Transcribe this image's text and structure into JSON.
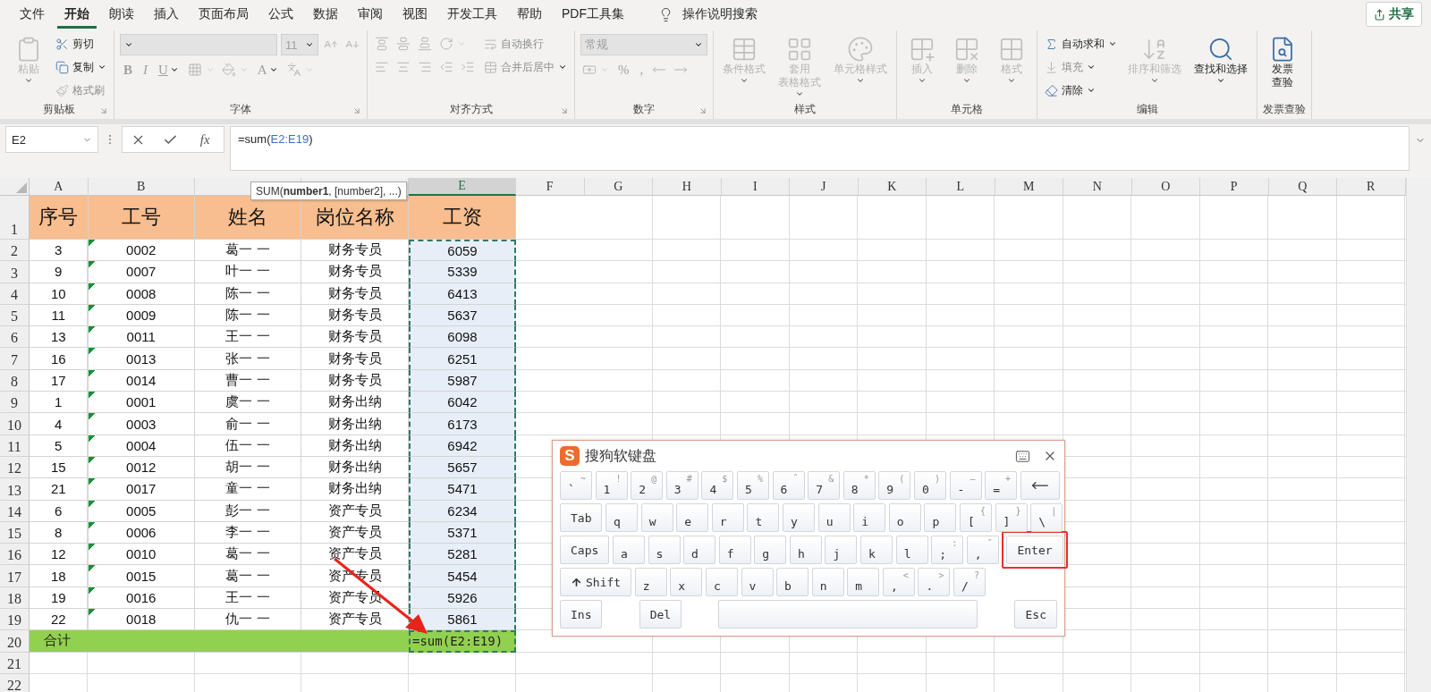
{
  "menu": {
    "tabs": [
      {
        "label": "文件",
        "selected": false
      },
      {
        "label": "开始",
        "selected": true
      },
      {
        "label": "朗读",
        "selected": false
      },
      {
        "label": "插入",
        "selected": false
      },
      {
        "label": "页面布局",
        "selected": false
      },
      {
        "label": "公式",
        "selected": false
      },
      {
        "label": "数据",
        "selected": false
      },
      {
        "label": "审阅",
        "selected": false
      },
      {
        "label": "视图",
        "selected": false
      },
      {
        "label": "开发工具",
        "selected": false
      },
      {
        "label": "帮助",
        "selected": false
      },
      {
        "label": "PDF工具集",
        "selected": false
      }
    ],
    "search": "操作说明搜索",
    "share": "共享"
  },
  "ribbon": {
    "groups": [
      {
        "label": "剪贴板",
        "launcher": true,
        "columns": [
          [
            [
              {
                "kind": "large",
                "label": "粘贴",
                "disabled": true,
                "dropdown": true
              }
            ]
          ],
          [
            [
              {
                "kind": "small",
                "label": "剪切",
                "disabled": false,
                "dropdown": false
              }
            ],
            [
              {
                "kind": "small",
                "label": "复制",
                "disabled": false,
                "dropdown": true
              }
            ],
            [
              {
                "kind": "small",
                "label": "格式刷",
                "disabled": true,
                "dropdown": false
              }
            ]
          ]
        ]
      },
      {
        "label": "字体",
        "launcher": true,
        "columns": [
          [
            [
              {
                "kind": "wide-field",
                "disabled": true,
                "dropdown": true
              },
              {
                "kind": "narrow-field",
                "label": "11",
                "disabled": true,
                "dropdown": true
              },
              {
                "kind": "icon",
                "disabled": true,
                "dropdown": false
              },
              {
                "kind": "icon",
                "disabled": true,
                "dropdown": false
              }
            ],
            [
              {
                "kind": "bold",
                "label": "B",
                "disabled": true,
                "dropdown": false
              },
              {
                "kind": "italic",
                "label": "I",
                "disabled": true,
                "dropdown": false
              },
              {
                "kind": "underline",
                "label": "U",
                "disabled": true,
                "dropdown": true
              },
              {
                "kind": "icon",
                "disabled": true,
                "dropdown": true
              },
              {
                "kind": "icon",
                "disabled": true,
                "dropdown": true
              },
              {
                "kind": "glyph",
                "label": "A",
                "disabled": true,
                "dropdown": true
              },
              {
                "kind": "icon",
                "disabled": true,
                "dropdown": true
              }
            ]
          ]
        ]
      },
      {
        "label": "对齐方式",
        "launcher": true,
        "columns": [
          [
            [
              {
                "kind": "icon",
                "disabled": true,
                "dropdown": false
              },
              {
                "kind": "icon",
                "disabled": true,
                "dropdown": false
              },
              {
                "kind": "icon",
                "disabled": true,
                "dropdown": false
              },
              {
                "kind": "icon",
                "disabled": true,
                "dropdown": true
              }
            ],
            [
              {
                "kind": "icon",
                "disabled": true,
                "dropdown": false
              },
              {
                "kind": "icon",
                "disabled": true,
                "dropdown": false
              },
              {
                "kind": "icon",
                "disabled": true,
                "dropdown": false
              },
              {
                "kind": "icon",
                "disabled": true,
                "dropdown": false
              },
              {
                "kind": "icon",
                "disabled": true,
                "dropdown": false
              }
            ]
          ],
          [
            [
              {
                "kind": "small",
                "label": "自动换行",
                "disabled": true,
                "dropdown": false
              }
            ],
            [
              {
                "kind": "small",
                "label": "合并后居中",
                "disabled": true,
                "dropdown": true
              }
            ]
          ]
        ]
      },
      {
        "label": "数字",
        "launcher": true,
        "columns": [
          [
            [
              {
                "kind": "medium-field",
                "label": "常规",
                "disabled": true,
                "dropdown": true
              }
            ],
            [
              {
                "kind": "icon",
                "disabled": true,
                "dropdown": true
              },
              {
                "kind": "glyph",
                "label": "%",
                "disabled": true,
                "dropdown": false
              },
              {
                "kind": "glyph",
                "label": ",",
                "disabled": true,
                "dropdown": false
              },
              {
                "kind": "icon",
                "disabled": true,
                "dropdown": false
              },
              {
                "kind": "icon",
                "disabled": true,
                "dropdown": false
              }
            ]
          ]
        ]
      },
      {
        "label": "样式",
        "launcher": false,
        "columns": [
          [
            [
              {
                "kind": "large",
                "label": "条件格式",
                "disabled": true,
                "dropdown": true
              }
            ]
          ],
          [
            [
              {
                "kind": "large",
                "label": [
                  "套用",
                  "表格格式"
                ],
                "disabled": true,
                "dropdown": true
              }
            ]
          ],
          [
            [
              {
                "kind": "large",
                "label": "单元格样式",
                "disabled": true,
                "dropdown": true
              }
            ]
          ]
        ]
      },
      {
        "label": "单元格",
        "launcher": false,
        "columns": [
          [
            [
              {
                "kind": "large",
                "label": "插入",
                "disabled": true,
                "dropdown": true
              }
            ]
          ],
          [
            [
              {
                "kind": "large",
                "label": "删除",
                "disabled": true,
                "dropdown": true
              }
            ]
          ],
          [
            [
              {
                "kind": "large",
                "label": "格式",
                "disabled": true,
                "dropdown": true
              }
            ]
          ]
        ]
      },
      {
        "label": "编辑",
        "launcher": false,
        "columns": [
          [
            [
              {
                "kind": "small",
                "label": "自动求和",
                "disabled": false,
                "dropdown": true
              }
            ],
            [
              {
                "kind": "small",
                "label": "填充",
                "disabled": true,
                "dropdown": true
              }
            ],
            [
              {
                "kind": "small",
                "label": "清除",
                "disabled": false,
                "dropdown": true
              }
            ]
          ],
          [
            [
              {
                "kind": "large",
                "label": "排序和筛选",
                "disabled": true,
                "dropdown": true
              }
            ]
          ],
          [
            [
              {
                "kind": "large",
                "label": "查找和选择",
                "disabled": false,
                "dropdown": true
              }
            ]
          ]
        ]
      },
      {
        "label": "发票查验",
        "launcher": false,
        "columns": [
          [
            [
              {
                "kind": "large",
                "label": [
                  "发票",
                  "查验"
                ],
                "disabled": false,
                "dropdown": false
              }
            ]
          ]
        ]
      }
    ]
  },
  "formula_bar": {
    "name_box": "E2",
    "function_label": "fx",
    "formula": {
      "before": "=sum(",
      "reference": "E2:E19",
      "after": ")"
    }
  },
  "tooltip": "SUM(**number1**, [number2], ...)",
  "sheet": {
    "column_headers": [
      {
        "label": "A",
        "selected": false
      },
      {
        "label": "B",
        "selected": false
      },
      {
        "selected": false
      },
      {
        "selected": false
      },
      {
        "label": "E",
        "selected": true
      },
      {
        "label": "F",
        "selected": false
      },
      {
        "label": "G",
        "selected": false
      },
      {
        "label": "H",
        "selected": false
      },
      {
        "label": "I",
        "selected": false
      },
      {
        "label": "J",
        "selected": false
      },
      {
        "label": "K",
        "selected": false
      },
      {
        "label": "L",
        "selected": false
      },
      {
        "label": "M",
        "selected": false
      },
      {
        "label": "N",
        "selected": false
      },
      {
        "label": "O",
        "selected": false
      },
      {
        "label": "P",
        "selected": false
      },
      {
        "label": "Q",
        "selected": false
      },
      {
        "label": "R",
        "selected": false
      }
    ],
    "row_numbers": [
      "1",
      "2",
      "3",
      "4",
      "5",
      "6",
      "7",
      "8",
      "9",
      "10",
      "11",
      "12",
      "13",
      "14",
      "15",
      "16",
      "17",
      "18",
      "19",
      "20",
      "21",
      "22"
    ],
    "header_row": [
      "序号",
      "工号",
      "姓名",
      "岗位名称",
      "工资"
    ],
    "rows": [
      {
        "cells": [
          "3",
          "0002",
          "葛一 一",
          "财务专员",
          "6059"
        ],
        "flagged": true,
        "in_range": true
      },
      {
        "cells": [
          "9",
          "0007",
          "叶一 一",
          "财务专员",
          "5339"
        ],
        "flagged": true,
        "in_range": true
      },
      {
        "cells": [
          "10",
          "0008",
          "陈一 一",
          "财务专员",
          "6413"
        ],
        "flagged": true,
        "in_range": true
      },
      {
        "cells": [
          "11",
          "0009",
          "陈一 一",
          "财务专员",
          "5637"
        ],
        "flagged": true,
        "in_range": true
      },
      {
        "cells": [
          "13",
          "0011",
          "王一 一",
          "财务专员",
          "6098"
        ],
        "flagged": true,
        "in_range": true
      },
      {
        "cells": [
          "16",
          "0013",
          "张一 一",
          "财务专员",
          "6251"
        ],
        "flagged": true,
        "in_range": true
      },
      {
        "cells": [
          "17",
          "0014",
          "曹一 一",
          "财务专员",
          "5987"
        ],
        "flagged": true,
        "in_range": true
      },
      {
        "cells": [
          "1",
          "0001",
          "虞一 一",
          "财务出纳",
          "6042"
        ],
        "flagged": true,
        "in_range": true
      },
      {
        "cells": [
          "4",
          "0003",
          "俞一 一",
          "财务出纳",
          "6173"
        ],
        "flagged": true,
        "in_range": true
      },
      {
        "cells": [
          "5",
          "0004",
          "伍一 一",
          "财务出纳",
          "6942"
        ],
        "flagged": true,
        "in_range": true
      },
      {
        "cells": [
          "15",
          "0012",
          "胡一 一",
          "财务出纳",
          "5657"
        ],
        "flagged": true,
        "in_range": true
      },
      {
        "cells": [
          "21",
          "0017",
          "童一 一",
          "财务出纳",
          "5471"
        ],
        "flagged": true,
        "in_range": true
      },
      {
        "cells": [
          "6",
          "0005",
          "彭一 一",
          "资产专员",
          "6234"
        ],
        "flagged": true,
        "in_range": true
      },
      {
        "cells": [
          "8",
          "0006",
          "李一 一",
          "资产专员",
          "5371"
        ],
        "flagged": true,
        "in_range": true
      },
      {
        "cells": [
          "12",
          "0010",
          "葛一 一",
          "资产专员",
          "5281"
        ],
        "flagged": true,
        "in_range": true
      },
      {
        "cells": [
          "18",
          "0015",
          "葛一 一",
          "资产专员",
          "5454"
        ],
        "flagged": true,
        "in_range": true
      },
      {
        "cells": [
          "19",
          "0016",
          "王一 一",
          "资产专员",
          "5926"
        ],
        "flagged": true,
        "in_range": true
      },
      {
        "cells": [
          "22",
          "0018",
          "仇一 一",
          "资产专员",
          "5861"
        ],
        "flagged": true,
        "in_range": true
      }
    ],
    "total_row": {
      "label": "合计",
      "formula": "=sum(E2:E19)"
    }
  },
  "keyboard": {
    "logo": "S",
    "title": "搜狗软键盘",
    "rows": [
      {
        "keys": [
          {
            "kind": "char",
            "main": "`",
            "shift": "~"
          },
          {
            "kind": "char",
            "main": "1",
            "shift": "!"
          },
          {
            "kind": "char",
            "main": "2",
            "shift": "@"
          },
          {
            "kind": "char",
            "main": "3",
            "shift": "#"
          },
          {
            "kind": "char",
            "main": "4",
            "shift": "$"
          },
          {
            "kind": "char",
            "main": "5",
            "shift": "%"
          },
          {
            "kind": "char",
            "main": "6",
            "shift": "ˆ"
          },
          {
            "kind": "char",
            "main": "7",
            "shift": "&"
          },
          {
            "kind": "char",
            "main": "8",
            "shift": "*"
          },
          {
            "kind": "char",
            "main": "9",
            "shift": "("
          },
          {
            "kind": "char",
            "main": "0",
            "shift": ")"
          },
          {
            "kind": "char",
            "main": "-",
            "shift": "—"
          },
          {
            "kind": "char",
            "main": "=",
            "shift": "+"
          },
          {
            "kind": "backspace",
            "highlighted": false
          }
        ]
      },
      {
        "keys": [
          {
            "kind": "function",
            "main": "Tab",
            "highlighted": false
          },
          {
            "kind": "char",
            "main": "q"
          },
          {
            "kind": "char",
            "main": "w"
          },
          {
            "kind": "char",
            "main": "e"
          },
          {
            "kind": "char",
            "main": "r"
          },
          {
            "kind": "char",
            "main": "t"
          },
          {
            "kind": "char",
            "main": "y"
          },
          {
            "kind": "char",
            "main": "u"
          },
          {
            "kind": "char",
            "main": "i"
          },
          {
            "kind": "char",
            "main": "o"
          },
          {
            "kind": "char",
            "main": "p"
          },
          {
            "kind": "char",
            "main": "[",
            "shift": "{"
          },
          {
            "kind": "char",
            "main": "]",
            "shift": "}"
          },
          {
            "kind": "char",
            "main": "\\",
            "shift": "|"
          }
        ]
      },
      {
        "keys": [
          {
            "kind": "function",
            "main": "Caps",
            "highlighted": false
          },
          {
            "kind": "char",
            "main": "a"
          },
          {
            "kind": "char",
            "main": "s"
          },
          {
            "kind": "char",
            "main": "d"
          },
          {
            "kind": "char",
            "main": "f"
          },
          {
            "kind": "char",
            "main": "g"
          },
          {
            "kind": "char",
            "main": "h"
          },
          {
            "kind": "char",
            "main": "j"
          },
          {
            "kind": "char",
            "main": "k"
          },
          {
            "kind": "char",
            "main": "l"
          },
          {
            "kind": "char",
            "main": ";",
            "shift": ":"
          },
          {
            "kind": "char",
            "main": ",",
            "shift": "″"
          },
          {
            "kind": "function",
            "main": "Enter",
            "highlighted": true
          }
        ]
      },
      {
        "keys": [
          {
            "kind": "shift",
            "main": "Shift",
            "highlighted": false
          },
          {
            "kind": "char",
            "main": "z"
          },
          {
            "kind": "char",
            "main": "x"
          },
          {
            "kind": "char",
            "main": "c"
          },
          {
            "kind": "char",
            "main": "v"
          },
          {
            "kind": "char",
            "main": "b"
          },
          {
            "kind": "char",
            "main": "n"
          },
          {
            "kind": "char",
            "main": "m"
          },
          {
            "kind": "char",
            "main": ",",
            "shift": "<"
          },
          {
            "kind": "char",
            "main": ".",
            "shift": ">"
          },
          {
            "kind": "char",
            "main": "/",
            "shift": "?"
          }
        ]
      },
      {
        "keys": [
          {
            "kind": "function",
            "main": "Ins",
            "highlighted": false
          },
          {
            "kind": "function",
            "main": "Del",
            "highlighted": false
          },
          {
            "kind": "space",
            "highlighted": false
          },
          {
            "kind": "function",
            "main": "Esc",
            "highlighted": false
          }
        ]
      }
    ]
  }
}
